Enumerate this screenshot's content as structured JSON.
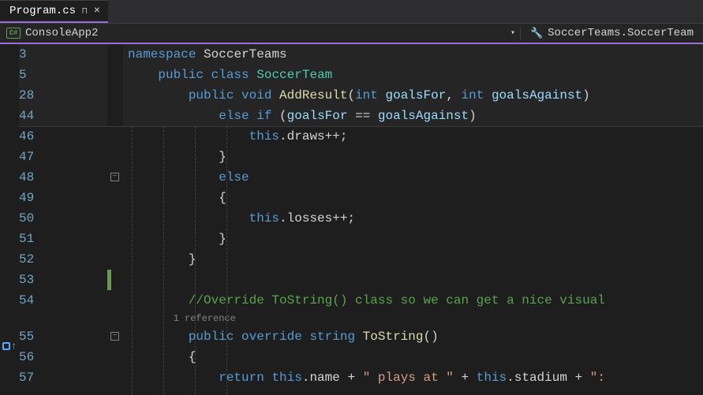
{
  "tab": {
    "filename": "Program.cs",
    "pin_glyph": "⊓",
    "close_glyph": "×"
  },
  "nav": {
    "project": "ConsoleApp2",
    "symbol": "SoccerTeams.SoccerTeam",
    "cs_label": "C#"
  },
  "gutter_nums": [
    "3",
    "5",
    "28",
    "44",
    "46",
    "47",
    "48",
    "49",
    "50",
    "51",
    "52",
    "53",
    "54",
    "",
    "55",
    "56",
    "57"
  ],
  "codelens": {
    "references": "1 reference"
  },
  "code": {
    "l3": {
      "kw1": "namespace",
      "ns": "SoccerTeams"
    },
    "l5": {
      "kw1": "public",
      "kw2": "class",
      "name": "SoccerTeam"
    },
    "l28": {
      "kw1": "public",
      "kw2": "void",
      "name": "AddResult",
      "p1t": "int",
      "p1n": "goalsFor",
      "p2t": "int",
      "p2n": "goalsAgainst"
    },
    "l44": {
      "kw1": "else",
      "kw2": "if",
      "v1": "goalsFor",
      "op": "==",
      "v2": "goalsAgainst"
    },
    "l46": {
      "kw": "this",
      "prop": "draws",
      "op": "++;"
    },
    "l47": {
      "b": "}"
    },
    "l48": {
      "kw": "else"
    },
    "l49": {
      "b": "{"
    },
    "l50": {
      "kw": "this",
      "prop": "losses",
      "op": "++;"
    },
    "l51": {
      "b": "}"
    },
    "l52": {
      "b": "}"
    },
    "l54": {
      "c": "//Override ToString() class so we can get a nice visual"
    },
    "l55": {
      "kw1": "public",
      "kw2": "override",
      "kw3": "string",
      "name": "ToString"
    },
    "l56": {
      "b": "{"
    },
    "l57": {
      "kw1": "return",
      "kw2a": "this",
      "p1": "name",
      "s1": "\" plays at \"",
      "kw2b": "this",
      "p2": "stadium",
      "s2": "\":"
    }
  }
}
